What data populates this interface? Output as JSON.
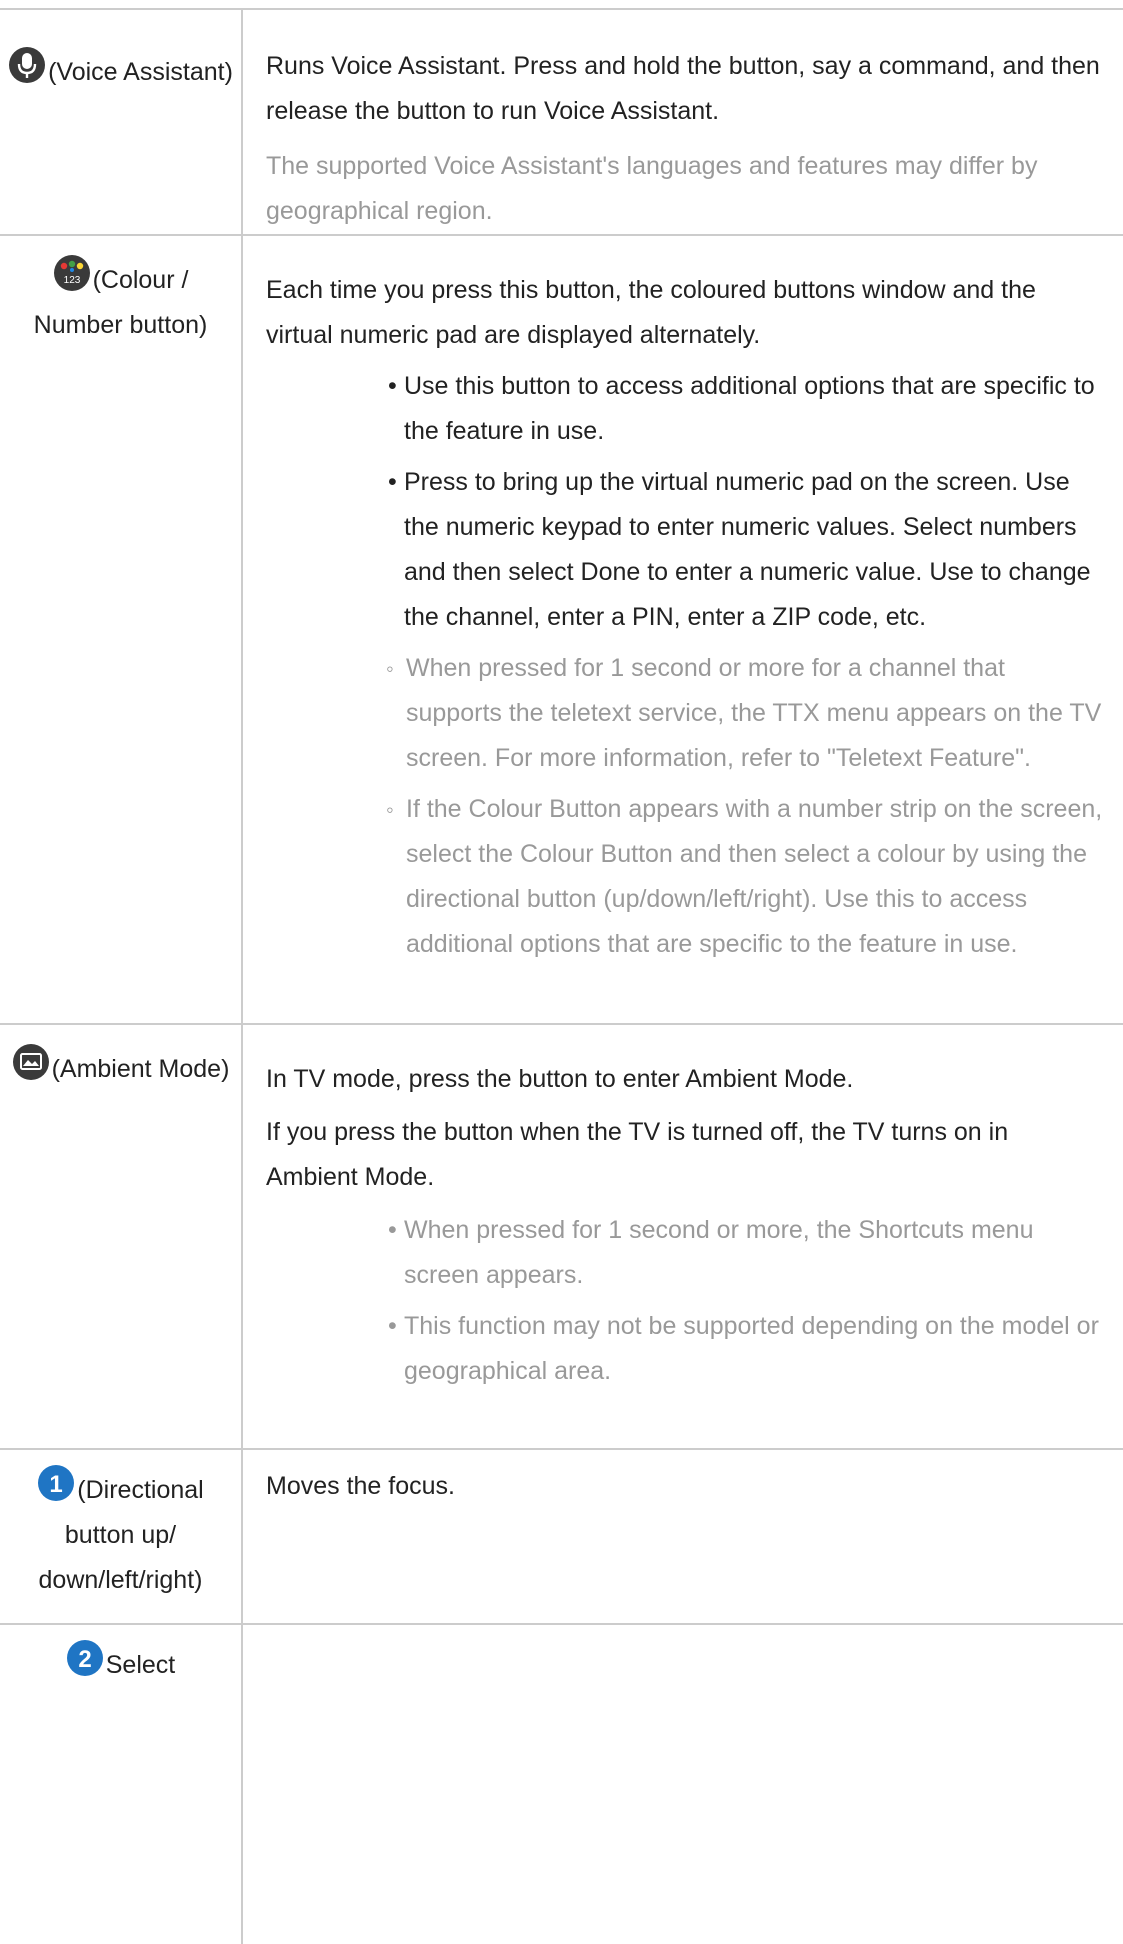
{
  "rows": [
    {
      "icon": "microphone-icon",
      "key_label": "(Voice Assistant)",
      "main": "Runs Voice Assistant. Press and hold the button, say a command, and then release the button to run Voice Assistant.",
      "note": "The supported Voice Assistant's languages and features may differ by geographical region."
    },
    {
      "icon": "colour-number-icon",
      "icon_text": "123",
      "key_label": "(Colour / Number button)",
      "main": "Each time you press this button, the coloured buttons window and the virtual numeric pad are displayed alternately.",
      "bullets": [
        "Use this button to access additional options that are specific to the feature in use.",
        "Press to bring up the virtual numeric pad on the screen. Use the numeric keypad to enter numeric values. Select numbers and then select Done to enter a numeric value. Use to change the channel, enter a PIN, enter a ZIP code, etc."
      ],
      "sub_bullets": [
        "When pressed for 1 second or more for a channel that supports the teletext service, the TTX menu appears on the TV screen. For more information, refer to \"Teletext Feature\".",
        "If the Colour Button appears with a number strip on the screen, select the Colour Button and then select a colour by using the directional button (up/down/left/right). Use this to access additional options that are specific to the feature in use."
      ]
    },
    {
      "icon": "ambient-mode-icon",
      "key_label": "(Ambient Mode)",
      "main_1": "In TV mode, press the button to enter Ambient Mode.",
      "main_2": "If you press the button when the TV is turned off, the TV turns on in Ambient Mode.",
      "note_bullets": [
        "When pressed for 1 second or more, the Shortcuts menu screen appears.",
        "This function may not be supported depending on the model or geographical area."
      ]
    },
    {
      "icon": "number-1-icon",
      "icon_text": "1",
      "key_label": "(Directional button up/ down/left/right)",
      "main": "Moves the focus."
    },
    {
      "icon": "number-2-icon",
      "icon_text": "2",
      "key_label": "Select"
    }
  ],
  "colors": {
    "border": "#cccccc",
    "text": "#222222",
    "note_text": "#999999",
    "icon_dark": "#3a3a3a",
    "icon_blue": "#1f75c4"
  }
}
